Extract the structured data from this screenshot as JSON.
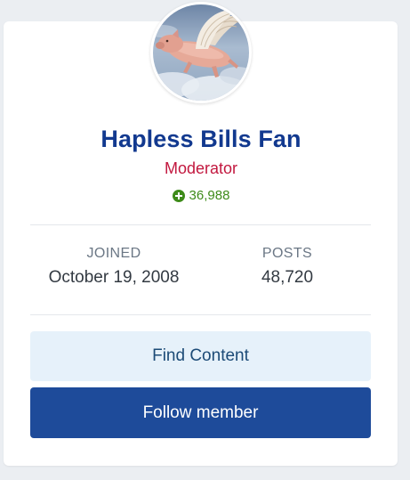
{
  "profile": {
    "name": "Hapless Bills Fan",
    "role": "Moderator",
    "reputation": "36,988"
  },
  "stats": {
    "joined_label": "JOINED",
    "joined_value": "October 19, 2008",
    "posts_label": "POSTS",
    "posts_value": "48,720"
  },
  "actions": {
    "find_content": "Find Content",
    "follow_member": "Follow member"
  },
  "colors": {
    "name": "#12398f",
    "role": "#c2183f",
    "reputation": "#3e8b1a",
    "follow_button": "#1e4b9a",
    "find_button": "#e6f1fa"
  },
  "icons": {
    "reputation": "plus-circle-icon"
  }
}
